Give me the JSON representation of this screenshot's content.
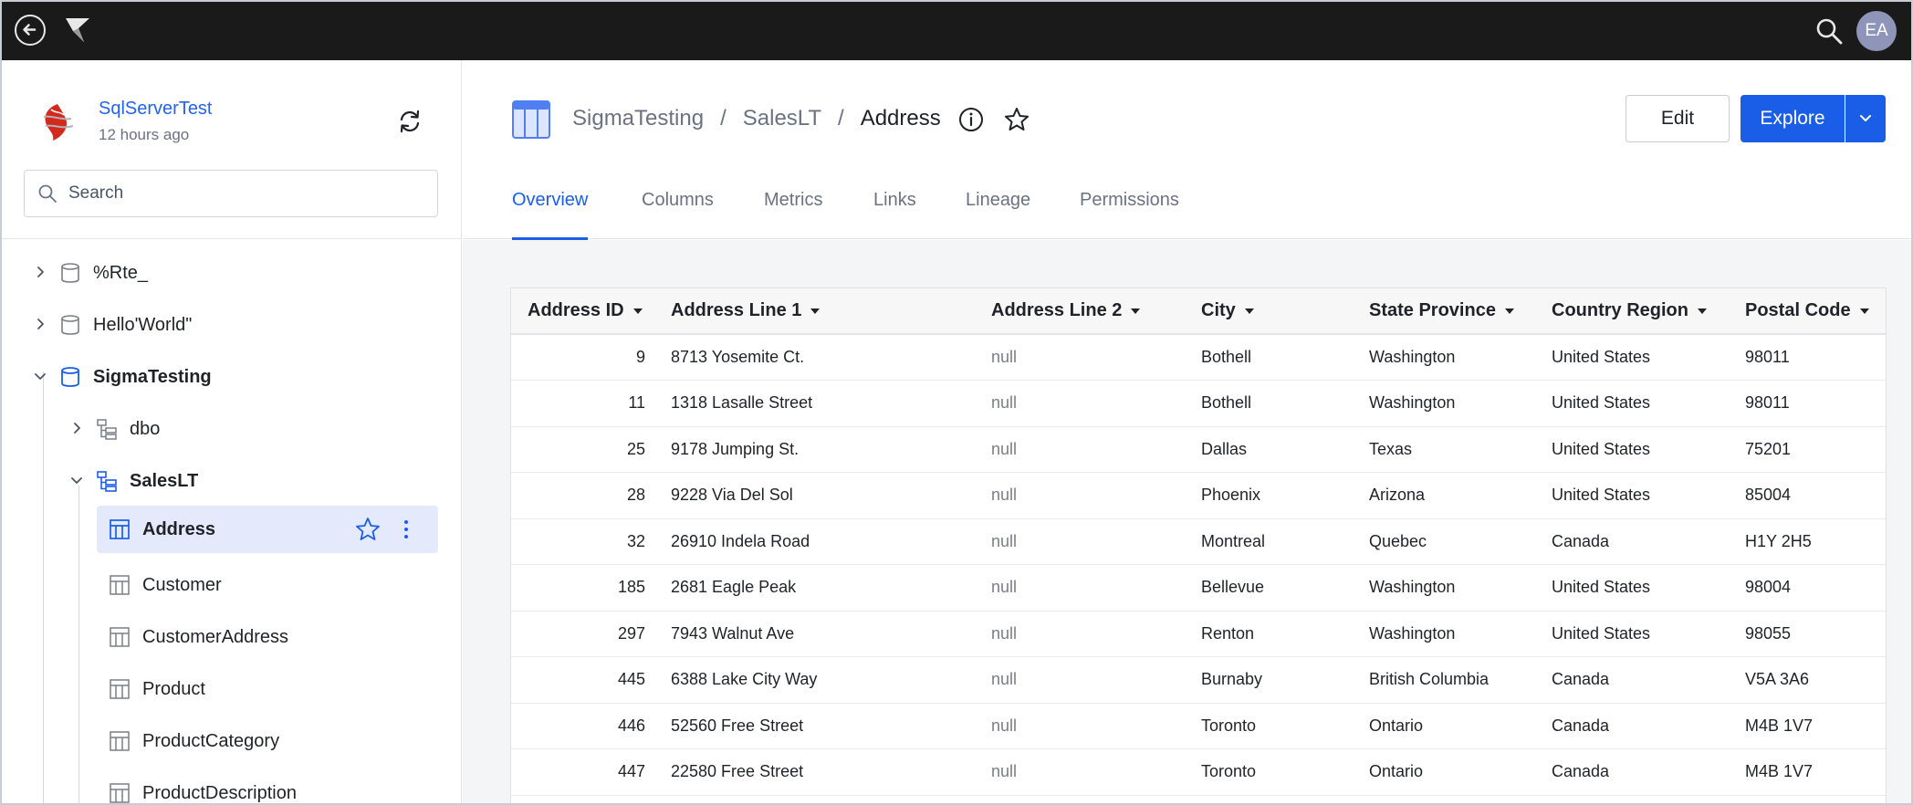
{
  "topbar": {
    "avatar_initials": "EA"
  },
  "connection": {
    "name": "SqlServerTest",
    "updated": "12 hours ago"
  },
  "search": {
    "placeholder": "Search"
  },
  "tree": {
    "items": [
      {
        "label": "%Rte_"
      },
      {
        "label": "Hello'World\""
      },
      {
        "label": "SigmaTesting"
      },
      {
        "label": "dbo"
      },
      {
        "label": "SalesLT"
      },
      {
        "label": "Address"
      },
      {
        "label": "Customer"
      },
      {
        "label": "CustomerAddress"
      },
      {
        "label": "Product"
      },
      {
        "label": "ProductCategory"
      },
      {
        "label": "ProductDescription"
      }
    ]
  },
  "breadcrumb": {
    "database": "SigmaTesting",
    "schema": "SalesLT",
    "table": "Address",
    "separator": "/"
  },
  "actions": {
    "edit_label": "Edit",
    "explore_label": "Explore"
  },
  "tabs": [
    {
      "label": "Overview"
    },
    {
      "label": "Columns"
    },
    {
      "label": "Metrics"
    },
    {
      "label": "Links"
    },
    {
      "label": "Lineage"
    },
    {
      "label": "Permissions"
    }
  ],
  "table": {
    "columns": [
      "Address ID",
      "Address Line 1",
      "Address Line 2",
      "City",
      "State Province",
      "Country Region",
      "Postal Code"
    ],
    "rows": [
      [
        "9",
        "8713 Yosemite Ct.",
        "null",
        "Bothell",
        "Washington",
        "United States",
        "98011"
      ],
      [
        "11",
        "1318 Lasalle Street",
        "null",
        "Bothell",
        "Washington",
        "United States",
        "98011"
      ],
      [
        "25",
        "9178 Jumping St.",
        "null",
        "Dallas",
        "Texas",
        "United States",
        "75201"
      ],
      [
        "28",
        "9228 Via Del Sol",
        "null",
        "Phoenix",
        "Arizona",
        "United States",
        "85004"
      ],
      [
        "32",
        "26910 Indela Road",
        "null",
        "Montreal",
        "Quebec",
        "Canada",
        "H1Y 2H5"
      ],
      [
        "185",
        "2681 Eagle Peak",
        "null",
        "Bellevue",
        "Washington",
        "United States",
        "98004"
      ],
      [
        "297",
        "7943 Walnut Ave",
        "null",
        "Renton",
        "Washington",
        "United States",
        "98055"
      ],
      [
        "445",
        "6388 Lake City Way",
        "null",
        "Burnaby",
        "British Columbia",
        "Canada",
        "V5A 3A6"
      ],
      [
        "446",
        "52560 Free Street",
        "null",
        "Toronto",
        "Ontario",
        "Canada",
        "M4B 1V7"
      ],
      [
        "447",
        "22580 Free Street",
        "null",
        "Toronto",
        "Ontario",
        "Canada",
        "M4B 1V7"
      ]
    ]
  },
  "colors": {
    "accent": "#1a5ee8",
    "topbar": "#1a1a1a",
    "selected": "#e4e9fb"
  }
}
